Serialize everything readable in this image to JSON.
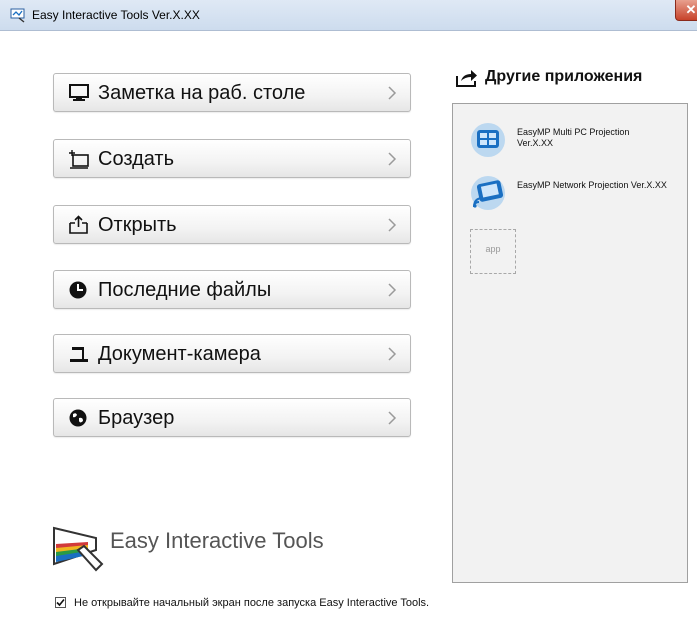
{
  "window": {
    "title": "Easy Interactive Tools Ver.X.XX",
    "close_glyph": "✕"
  },
  "menu": {
    "items": [
      {
        "label": "Заметка на раб. столе",
        "icon": "monitor-icon"
      },
      {
        "label": "Создать",
        "icon": "new-board-icon"
      },
      {
        "label": "Открыть",
        "icon": "open-folder-icon"
      },
      {
        "label": "Последние файлы",
        "icon": "clock-icon"
      },
      {
        "label": "Документ-камера",
        "icon": "document-camera-icon"
      },
      {
        "label": "Браузер",
        "icon": "globe-icon"
      }
    ]
  },
  "other_apps": {
    "title": "Другие приложения",
    "apps": [
      {
        "name": "EasyMP Multi PC Projection Ver.X.XX",
        "icon": "multi-pc-projection-icon"
      },
      {
        "name": "EasyMP Network Projection Ver.X.XX",
        "icon": "network-projection-icon"
      }
    ],
    "placeholder": "app"
  },
  "branding": {
    "logo_text": "Easy Interactive Tools"
  },
  "startup_checkbox": {
    "label": "Не открывайте начальный экран после запуска Easy Interactive Tools.",
    "checked": true
  },
  "colors": {
    "accent": "#1a6fc2",
    "panel_bg": "#f2f2f2",
    "button_border": "#b9b9b9"
  }
}
